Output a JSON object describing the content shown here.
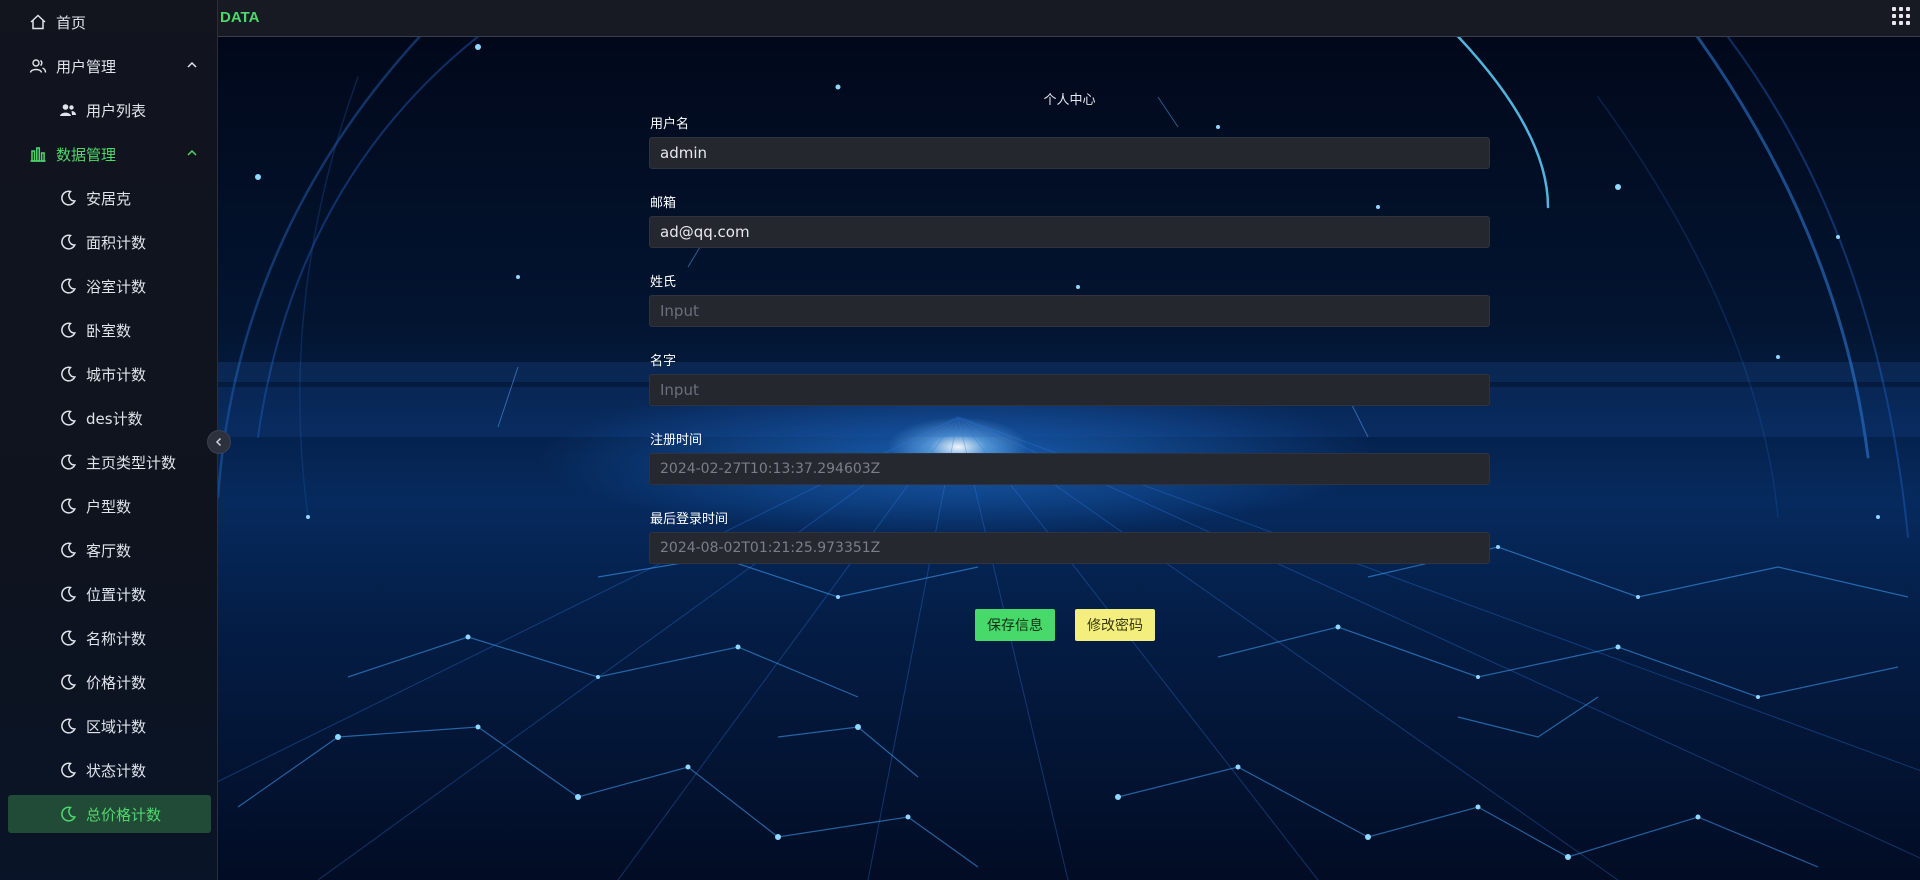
{
  "header": {
    "brand": "DATA"
  },
  "sidebar": {
    "home": "首页",
    "user_group": "用户管理",
    "user_list": "用户列表",
    "data_group": "数据管理",
    "data_items": [
      "安居克",
      "面积计数",
      "浴室计数",
      "卧室数",
      "城市计数",
      "des计数",
      "主页类型计数",
      "户型数",
      "客厅数",
      "位置计数",
      "名称计数",
      "价格计数",
      "区域计数",
      "状态计数",
      "总价格计数"
    ],
    "active_item": "总价格计数"
  },
  "form": {
    "title": "个人中心",
    "fields": [
      {
        "label": "用户名",
        "value": "admin",
        "placeholder": ""
      },
      {
        "label": "邮箱",
        "value": "ad@qq.com",
        "placeholder": ""
      },
      {
        "label": "姓氏",
        "value": "",
        "placeholder": "Input"
      },
      {
        "label": "名字",
        "value": "",
        "placeholder": "Input"
      },
      {
        "label": "注册时间",
        "value": "2024-02-27T10:13:37.294603Z",
        "placeholder": ""
      },
      {
        "label": "最后登录时间",
        "value": "2024-08-02T01:21:25.973351Z",
        "placeholder": ""
      }
    ],
    "save_label": "保存信息",
    "password_label": "修改密码"
  },
  "colors": {
    "accent": "#4ed86c",
    "save_button": "#47d96a",
    "password_button": "#f3ee7e",
    "sidebar_bg": "#12151e",
    "input_bg": "#25272f"
  },
  "icons": {
    "home": "home-icon",
    "users": "users-icon",
    "user_list": "user-list-icon",
    "data": "bar-chart-icon",
    "data_item": "moon-icon",
    "collapse": "chevron-left-icon",
    "apps": "grid-icon"
  }
}
